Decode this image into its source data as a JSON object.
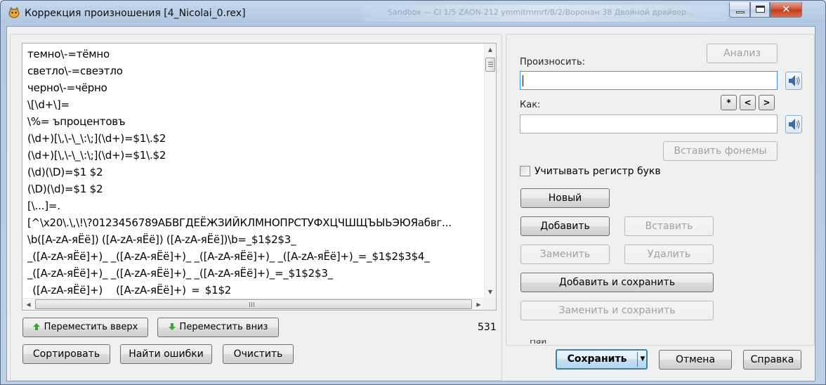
{
  "window": {
    "title": "Коррекция произношения [4_Nicolai_0.rex]",
    "background_window_title": "Sandbox — Cl 1/5 ZAON-212 ymmitrnmrf/B/2/Воронан 38 Двойной драйвер..."
  },
  "editor": {
    "lines": [
      "темно\\-=тёмно",
      "светло\\-=свеэтло",
      "черно\\-=чёрно",
      "\\[\\d+\\]=",
      "\\%= ъпроцентовъ",
      "(\\d+)[\\,\\-\\_\\:\\;](\\d+)=$1\\.$2",
      "(\\d+)[\\,\\-\\_\\:\\;](\\d+)=$1\\.$2",
      "(\\d)(\\D)=$1 $2",
      "(\\D)(\\d)=$1 $2",
      "[\\...]=.",
      "[^\\x20\\.\\,\\!\\?0123456789АБВГДЕЁЖЗИЙКЛМНОПРСТУФХЦЧШЩЪЫЬЭЮЯабвг...",
      "\\b([A-zA-яЁё]) ([A-zA-яЁё]) ([A-zA-яЁё])\\b=_$1$2$3_",
      "_([A-zA-яЁё]+)_ _([A-zA-яЁё]+)_ _([A-zA-яЁё]+)_ _([A-zA-яЁё]+)_=_$1$2$3$4_",
      "_([A-zA-яЁё]+)_ _([A-zA-яЁё]+)_ _([A-zA-яЁё]+)_=_$1$2$3_",
      "_([A-zA-яЁё]+)_ _([A-zA-яЁё]+)_=_$1$2_"
    ],
    "count": "531"
  },
  "left_buttons": {
    "move_up": "Переместить вверх",
    "move_down": "Переместить вниз",
    "sort": "Сортировать",
    "find_errors": "Найти ошибки",
    "clear": "Очистить"
  },
  "right_panel": {
    "analyze": "Анализ",
    "pronounce_label": "Произносить:",
    "pronounce_value": "",
    "as_label": "Как:",
    "as_value": "",
    "star_button": "*",
    "prev_button": "<",
    "next_button": ">",
    "insert_phonemes": "Вставить фонемы",
    "case_sensitive_label": "Учитывать регистр букв",
    "case_sensitive_checked": false,
    "new": "Новый",
    "add": "Добавить",
    "insert": "Вставить",
    "replace": "Заменить",
    "delete": "Удалить",
    "add_and_save": "Добавить и сохранить",
    "replace_and_save": "Заменить и сохранить",
    "cut_off_text": "Най"
  },
  "footer": {
    "save": "Сохранить",
    "cancel": "Отмена",
    "help": "Справка"
  },
  "colors": {
    "accent_blue": "#3c7fb1",
    "focus_blue": "#3399ff",
    "close_red": "#c1391b"
  }
}
